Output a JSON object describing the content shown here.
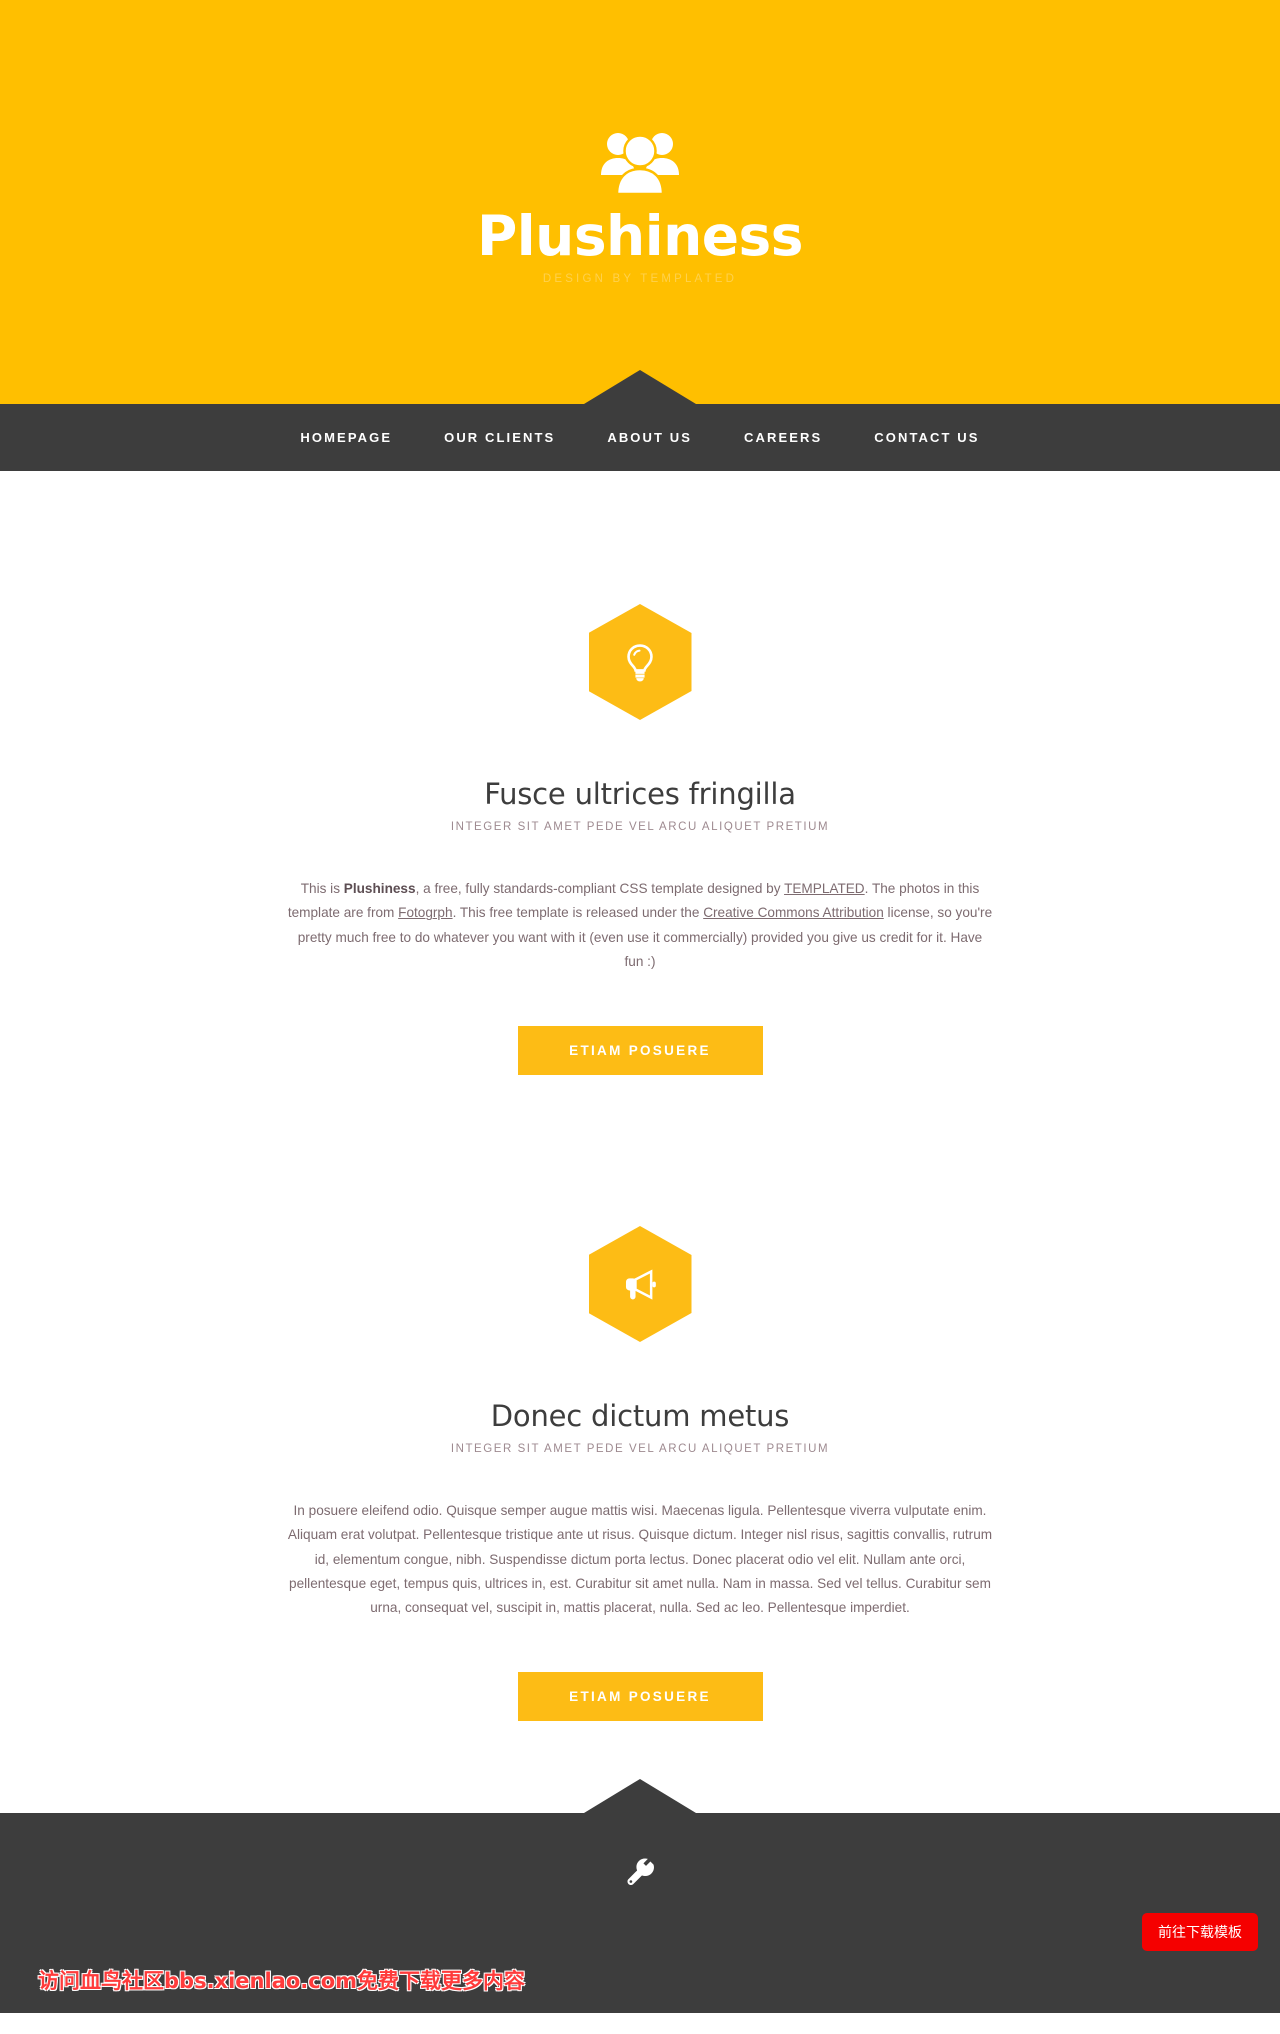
{
  "colors": {
    "brand_yellow": "#ffbf00",
    "hex_yellow": "#fdbc15",
    "dark": "#3d3d3d",
    "body_text": "#7d6b70",
    "subtitle": "#9e8a90",
    "tagline": "#ffd14d",
    "watermark_red": "#ff3b3b",
    "download_red": "#f50000"
  },
  "header": {
    "logo_icon": "users-group-icon",
    "title": "Plushiness",
    "tagline": "DESIGN BY TEMPLATED"
  },
  "nav": {
    "items": [
      {
        "label": "HOMEPAGE"
      },
      {
        "label": "OUR CLIENTS"
      },
      {
        "label": "ABOUT US"
      },
      {
        "label": "CAREERS"
      },
      {
        "label": "CONTACT US"
      }
    ]
  },
  "sections": [
    {
      "icon": "lightbulb-icon",
      "title": "Fusce ultrices fringilla",
      "subtitle": "INTEGER SIT AMET PEDE VEL ARCU ALIQUET PRETIUM",
      "body": {
        "p1": "This is ",
        "strong1": "Plushiness",
        "p2": ", a free, fully standards-compliant CSS template designed by ",
        "link1": "TEMPLATED",
        "p3": ". The photos in this template are from ",
        "link2": "Fotogrph",
        "p4": ". This free template is released under the ",
        "link3": "Creative Commons Attribution",
        "p5": " license, so you're pretty much free to do whatever you want with it (even use it commercially) provided you give us credit for it. Have fun :)"
      },
      "button": "ETIAM POSUERE"
    },
    {
      "icon": "megaphone-icon",
      "title": "Donec dictum metus",
      "subtitle": "INTEGER SIT AMET PEDE VEL ARCU ALIQUET PRETIUM",
      "body_text": "In posuere eleifend odio. Quisque semper augue mattis wisi. Maecenas ligula. Pellentesque viverra vulputate enim. Aliquam erat volutpat. Pellentesque tristique ante ut risus. Quisque dictum. Integer nisl risus, sagittis convallis, rutrum id, elementum congue, nibh. Suspendisse dictum porta lectus. Donec placerat odio vel elit. Nullam ante orci, pellentesque eget, tempus quis, ultrices in, est. Curabitur sit amet nulla. Nam in massa. Sed vel tellus. Curabitur sem urna, consequat vel, suscipit in, mattis placerat, nulla. Sed ac leo. Pellentesque imperdiet.",
      "button": "ETIAM POSUERE"
    }
  ],
  "footer": {
    "icon": "wrench-icon",
    "watermark": "访问血鸟社区bbs.xienlao.com免费下载更多内容",
    "download_button": "前往下载模板"
  }
}
